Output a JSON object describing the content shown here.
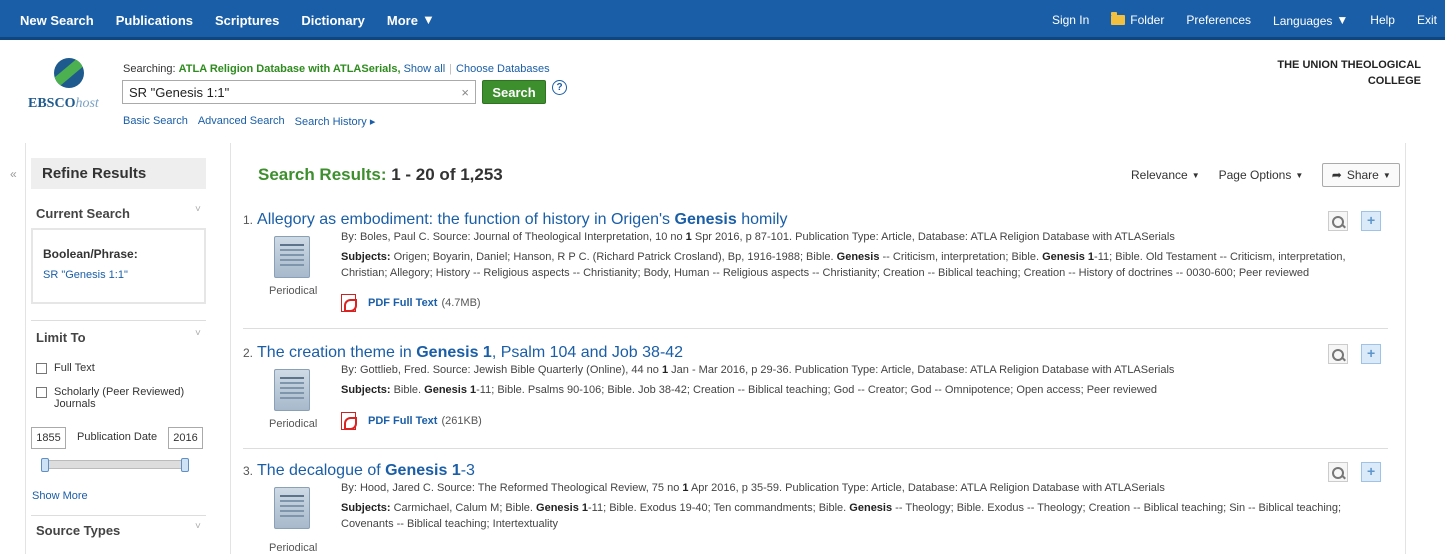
{
  "nav": {
    "left": [
      "New Search",
      "Publications",
      "Scriptures",
      "Dictionary",
      "More"
    ],
    "sign_in": "Sign In",
    "folder": "Folder",
    "preferences": "Preferences",
    "languages": "Languages",
    "help": "Help",
    "exit": "Exit"
  },
  "logo": {
    "word": "EBSCO",
    "suffix": "host"
  },
  "searching": {
    "prefix": "Searching:",
    "database": "ATLA Religion Database with ATLASerials,",
    "show_all": "Show all",
    "choose": "Choose Databases"
  },
  "search": {
    "query": "SR \"Genesis 1:1\"",
    "button": "Search",
    "help": "?"
  },
  "sublinks": [
    "Basic Search",
    "Advanced Search",
    "Search History ▸"
  ],
  "institution": [
    "THE UNION THEOLOGICAL",
    "COLLEGE"
  ],
  "sidebar": {
    "collapse": "«",
    "title": "Refine Results",
    "current_search": "Current Search",
    "boolean_label": "Boolean/Phrase:",
    "boolean_value": "SR \"Genesis 1:1\"",
    "limit_to": "Limit To",
    "full_text": "Full Text",
    "scholarly": "Scholarly (Peer Reviewed) Journals",
    "date_from": "1855",
    "date_label": "Publication Date",
    "date_to": "2016",
    "show_more": "Show More",
    "source_types": "Source Types",
    "chevron": "˅"
  },
  "results": {
    "heading": "Search Results:",
    "range": "1 - 20 of 1,253",
    "sort": "Relevance",
    "page_options": "Page Options",
    "share": "Share",
    "items": [
      {
        "num": "1.",
        "title_pre": "Allegory as embodiment: the function of history in Origen's ",
        "title_bold": "Genesis",
        "title_post": " homily",
        "by_pre": "By: Boles, Paul C. Source: Journal of Theological Interpretation, 10 no ",
        "by_bold": "1",
        "by_post": " Spr 2016, p 87-101. Publication Type: Article, Database: ATLA Religion Database with ATLASerials",
        "subj_label": "Subjects:",
        "subj_a": " Origen; Boyarin, Daniel; Hanson, R P C. (Richard Patrick Crosland), Bp, 1916-1988; Bible. ",
        "subj_b": "Genesis",
        "subj_c": " -- Criticism, interpretation; Bible. ",
        "subj_d": "Genesis 1",
        "subj_e": "-11; Bible. Old Testament -- Criticism, interpretation, Christian; Allegory; History -- Religious aspects -- Christianity; Body, Human -- Religious aspects -- Christianity; Creation -- Biblical teaching; Creation -- History of doctrines -- 0030-600; Peer reviewed",
        "type": "Periodical",
        "pdf": "PDF Full Text",
        "size": "(4.7MB)"
      },
      {
        "num": "2.",
        "title_pre": "The creation theme in ",
        "title_bold": "Genesis 1",
        "title_post": ", Psalm 104 and Job 38-42",
        "by_pre": "By: Gottlieb, Fred. Source: Jewish Bible Quarterly (Online), 44 no ",
        "by_bold": "1",
        "by_post": " Jan - Mar 2016, p 29-36. Publication Type: Article, Database: ATLA Religion Database with ATLASerials",
        "subj_label": "Subjects:",
        "subj_a": " Bible. ",
        "subj_b": "Genesis 1",
        "subj_c": "-11; Bible. Psalms 90-106; Bible. Job 38-42; Creation -- Biblical teaching; God -- Creator; God -- Omnipotence; Open access; Peer reviewed",
        "type": "Periodical",
        "pdf": "PDF Full Text",
        "size": "(261KB)"
      },
      {
        "num": "3.",
        "title_pre": "The decalogue of ",
        "title_bold": "Genesis 1",
        "title_post": "-3",
        "by_pre": "By: Hood, Jared C. Source: The Reformed Theological Review, 75 no ",
        "by_bold": "1",
        "by_post": " Apr 2016, p 35-59. Publication Type: Article, Database: ATLA Religion Database with ATLASerials",
        "subj_label": "Subjects:",
        "subj_a": " Carmichael, Calum M; Bible. ",
        "subj_b": "Genesis 1",
        "subj_c": "-11; Bible. Exodus 19-40; Ten commandments; Bible. ",
        "subj_d": "Genesis",
        "subj_e": " -- Theology; Bible. Exodus -- Theology; Creation -- Biblical teaching; Sin -- Biblical teaching; Covenants -- Biblical teaching; Intertextuality",
        "type": "Periodical"
      }
    ]
  }
}
